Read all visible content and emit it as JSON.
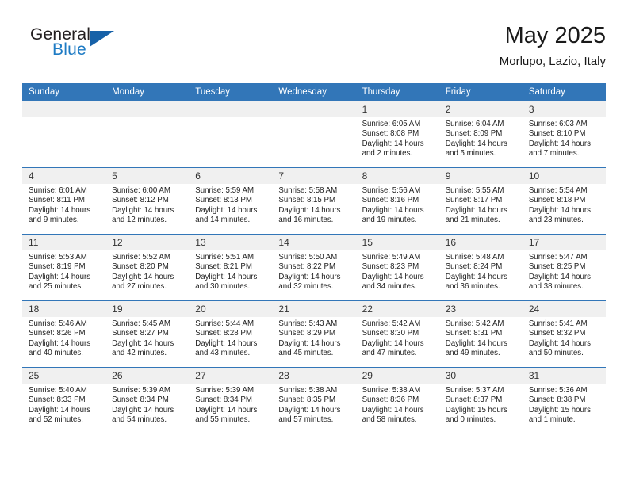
{
  "brand": {
    "word_one": "General",
    "word_two": "Blue",
    "icon": "triangle-logo",
    "accent_color": "#1e7bc4",
    "triangle_color": "#1661a8"
  },
  "header": {
    "title": "May 2025",
    "location": "Morlupo, Lazio, Italy"
  },
  "theme": {
    "header_bar_color": "#3276b8",
    "daynum_band_color": "#f0f0f0",
    "grid_line_color": "#3276b8"
  },
  "weekday_headers": [
    "Sunday",
    "Monday",
    "Tuesday",
    "Wednesday",
    "Thursday",
    "Friday",
    "Saturday"
  ],
  "weeks": [
    [
      {
        "day": "",
        "empty": true
      },
      {
        "day": "",
        "empty": true
      },
      {
        "day": "",
        "empty": true
      },
      {
        "day": "",
        "empty": true
      },
      {
        "day": "1",
        "sunrise": "Sunrise: 6:05 AM",
        "sunset": "Sunset: 8:08 PM",
        "daylight": "Daylight: 14 hours and 2 minutes."
      },
      {
        "day": "2",
        "sunrise": "Sunrise: 6:04 AM",
        "sunset": "Sunset: 8:09 PM",
        "daylight": "Daylight: 14 hours and 5 minutes."
      },
      {
        "day": "3",
        "sunrise": "Sunrise: 6:03 AM",
        "sunset": "Sunset: 8:10 PM",
        "daylight": "Daylight: 14 hours and 7 minutes."
      }
    ],
    [
      {
        "day": "4",
        "sunrise": "Sunrise: 6:01 AM",
        "sunset": "Sunset: 8:11 PM",
        "daylight": "Daylight: 14 hours and 9 minutes."
      },
      {
        "day": "5",
        "sunrise": "Sunrise: 6:00 AM",
        "sunset": "Sunset: 8:12 PM",
        "daylight": "Daylight: 14 hours and 12 minutes."
      },
      {
        "day": "6",
        "sunrise": "Sunrise: 5:59 AM",
        "sunset": "Sunset: 8:13 PM",
        "daylight": "Daylight: 14 hours and 14 minutes."
      },
      {
        "day": "7",
        "sunrise": "Sunrise: 5:58 AM",
        "sunset": "Sunset: 8:15 PM",
        "daylight": "Daylight: 14 hours and 16 minutes."
      },
      {
        "day": "8",
        "sunrise": "Sunrise: 5:56 AM",
        "sunset": "Sunset: 8:16 PM",
        "daylight": "Daylight: 14 hours and 19 minutes."
      },
      {
        "day": "9",
        "sunrise": "Sunrise: 5:55 AM",
        "sunset": "Sunset: 8:17 PM",
        "daylight": "Daylight: 14 hours and 21 minutes."
      },
      {
        "day": "10",
        "sunrise": "Sunrise: 5:54 AM",
        "sunset": "Sunset: 8:18 PM",
        "daylight": "Daylight: 14 hours and 23 minutes."
      }
    ],
    [
      {
        "day": "11",
        "sunrise": "Sunrise: 5:53 AM",
        "sunset": "Sunset: 8:19 PM",
        "daylight": "Daylight: 14 hours and 25 minutes."
      },
      {
        "day": "12",
        "sunrise": "Sunrise: 5:52 AM",
        "sunset": "Sunset: 8:20 PM",
        "daylight": "Daylight: 14 hours and 27 minutes."
      },
      {
        "day": "13",
        "sunrise": "Sunrise: 5:51 AM",
        "sunset": "Sunset: 8:21 PM",
        "daylight": "Daylight: 14 hours and 30 minutes."
      },
      {
        "day": "14",
        "sunrise": "Sunrise: 5:50 AM",
        "sunset": "Sunset: 8:22 PM",
        "daylight": "Daylight: 14 hours and 32 minutes."
      },
      {
        "day": "15",
        "sunrise": "Sunrise: 5:49 AM",
        "sunset": "Sunset: 8:23 PM",
        "daylight": "Daylight: 14 hours and 34 minutes."
      },
      {
        "day": "16",
        "sunrise": "Sunrise: 5:48 AM",
        "sunset": "Sunset: 8:24 PM",
        "daylight": "Daylight: 14 hours and 36 minutes."
      },
      {
        "day": "17",
        "sunrise": "Sunrise: 5:47 AM",
        "sunset": "Sunset: 8:25 PM",
        "daylight": "Daylight: 14 hours and 38 minutes."
      }
    ],
    [
      {
        "day": "18",
        "sunrise": "Sunrise: 5:46 AM",
        "sunset": "Sunset: 8:26 PM",
        "daylight": "Daylight: 14 hours and 40 minutes."
      },
      {
        "day": "19",
        "sunrise": "Sunrise: 5:45 AM",
        "sunset": "Sunset: 8:27 PM",
        "daylight": "Daylight: 14 hours and 42 minutes."
      },
      {
        "day": "20",
        "sunrise": "Sunrise: 5:44 AM",
        "sunset": "Sunset: 8:28 PM",
        "daylight": "Daylight: 14 hours and 43 minutes."
      },
      {
        "day": "21",
        "sunrise": "Sunrise: 5:43 AM",
        "sunset": "Sunset: 8:29 PM",
        "daylight": "Daylight: 14 hours and 45 minutes."
      },
      {
        "day": "22",
        "sunrise": "Sunrise: 5:42 AM",
        "sunset": "Sunset: 8:30 PM",
        "daylight": "Daylight: 14 hours and 47 minutes."
      },
      {
        "day": "23",
        "sunrise": "Sunrise: 5:42 AM",
        "sunset": "Sunset: 8:31 PM",
        "daylight": "Daylight: 14 hours and 49 minutes."
      },
      {
        "day": "24",
        "sunrise": "Sunrise: 5:41 AM",
        "sunset": "Sunset: 8:32 PM",
        "daylight": "Daylight: 14 hours and 50 minutes."
      }
    ],
    [
      {
        "day": "25",
        "sunrise": "Sunrise: 5:40 AM",
        "sunset": "Sunset: 8:33 PM",
        "daylight": "Daylight: 14 hours and 52 minutes."
      },
      {
        "day": "26",
        "sunrise": "Sunrise: 5:39 AM",
        "sunset": "Sunset: 8:34 PM",
        "daylight": "Daylight: 14 hours and 54 minutes."
      },
      {
        "day": "27",
        "sunrise": "Sunrise: 5:39 AM",
        "sunset": "Sunset: 8:34 PM",
        "daylight": "Daylight: 14 hours and 55 minutes."
      },
      {
        "day": "28",
        "sunrise": "Sunrise: 5:38 AM",
        "sunset": "Sunset: 8:35 PM",
        "daylight": "Daylight: 14 hours and 57 minutes."
      },
      {
        "day": "29",
        "sunrise": "Sunrise: 5:38 AM",
        "sunset": "Sunset: 8:36 PM",
        "daylight": "Daylight: 14 hours and 58 minutes."
      },
      {
        "day": "30",
        "sunrise": "Sunrise: 5:37 AM",
        "sunset": "Sunset: 8:37 PM",
        "daylight": "Daylight: 15 hours and 0 minutes."
      },
      {
        "day": "31",
        "sunrise": "Sunrise: 5:36 AM",
        "sunset": "Sunset: 8:38 PM",
        "daylight": "Daylight: 15 hours and 1 minute."
      }
    ]
  ]
}
